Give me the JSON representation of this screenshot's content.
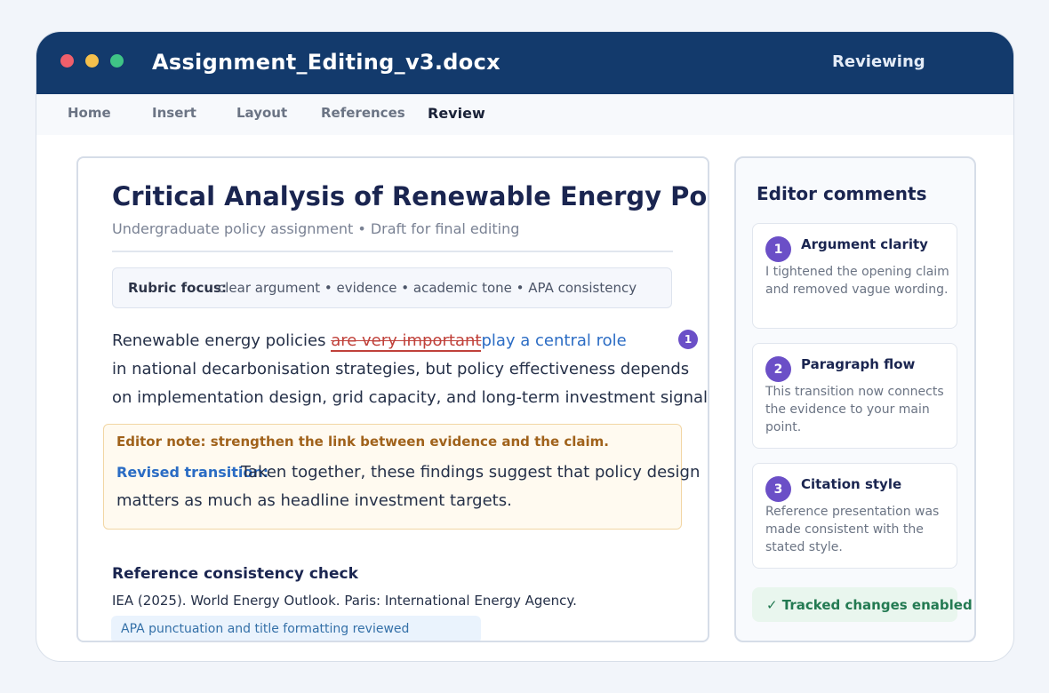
{
  "window": {
    "title": "Assignment_Editing_v3.docx",
    "mode": "Reviewing"
  },
  "tabs": [
    {
      "label": "Home",
      "active": false
    },
    {
      "label": "Insert",
      "active": false
    },
    {
      "label": "Layout",
      "active": false
    },
    {
      "label": "References",
      "active": false
    },
    {
      "label": "Review",
      "active": true
    }
  ],
  "document": {
    "title": "Critical Analysis of Renewable Energy Policy",
    "subtitle": "Undergraduate policy assignment • Draft for final editing",
    "rubric": {
      "label": "Rubric focus:",
      "text": "clear argument • evidence • academic tone • APA consistency"
    },
    "paragraph": {
      "prefix": "Renewable energy policies ",
      "deleted": "are very important",
      "inserted": "play a central role",
      "marker": "1",
      "line2": "in national decarbonisation strategies, but policy effectiveness depends",
      "line3": "on implementation design, grid capacity, and long-term investment signals."
    },
    "note": {
      "heading": "Editor note: strengthen the link between evidence and the claim.",
      "label": "Revised transition:",
      "line1": "Taken together, these findings suggest that policy design",
      "line2": "matters as much as headline investment targets."
    },
    "references": {
      "heading": "Reference consistency check",
      "entry": "IEA (2025). World Energy Outlook. Paris: International Energy Agency.",
      "badge": "APA punctuation and title formatting reviewed"
    }
  },
  "sidebar": {
    "title": "Editor comments",
    "comments": [
      {
        "number": "1",
        "title": "Argument clarity",
        "body": "I tightened the opening claim and removed vague wording."
      },
      {
        "number": "2",
        "title": "Paragraph flow",
        "body": "This transition now connects the evidence to your main point."
      },
      {
        "number": "3",
        "title": "Citation style",
        "body": "Reference presentation was made consistent with the stated style."
      }
    ],
    "status": "✓ Tracked changes enabled"
  },
  "colors": {
    "titlebar": "#133a6c",
    "deletion": "#c0413a",
    "insertion": "#2b6cc4",
    "comment_marker": "#6b4fc7",
    "status": "#237a52"
  }
}
